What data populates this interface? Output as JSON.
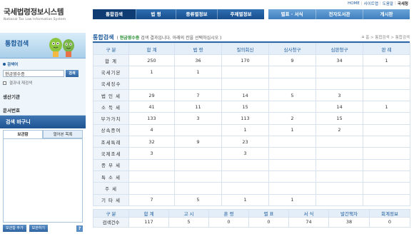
{
  "site": {
    "title_ko": "국세법령정보시스템",
    "title_en": "National Tax Law Information System"
  },
  "top_links": [
    "HOME",
    "사이트맵",
    "도움말",
    "국세청"
  ],
  "nav": {
    "group1": [
      "통합검색",
      "법 령",
      "종류별정보",
      "주제별정보"
    ],
    "group2": [
      "별표 · 서식",
      "전자도서관",
      "게시판"
    ],
    "active_index": 0
  },
  "sidebar": {
    "title": "통합검색",
    "search_label": "검색어",
    "search_value": "현금영수증",
    "search_button": "검색",
    "within_results": "결과내 재검색",
    "links": [
      "생산기관",
      "문서번호"
    ],
    "basket_title": "검색 바구니",
    "tabs": [
      "보관함",
      "열어본 목록"
    ],
    "buttons": [
      "보관함 추가",
      "보관하기"
    ],
    "help": "?"
  },
  "main": {
    "title": "통합검색",
    "subtitle_pre": "(",
    "keyword": "현금영수증",
    "subtitle_post": "검색 결과입니다. 아래의 칸을 선택하십시오 )",
    "breadcrumb": "홈 > 통합검색 > 통합검색"
  },
  "results_table": {
    "headers": [
      "구 분",
      "합 계",
      "법 령",
      "질의회신",
      "심사청구",
      "심판청구",
      "판 례"
    ],
    "rows": [
      [
        "합 계",
        "250",
        "36",
        "170",
        "9",
        "34",
        "1"
      ],
      [
        "국세기본",
        "1",
        "1",
        "",
        "",
        "",
        ""
      ],
      [
        "국세징수",
        "",
        "",
        "",
        "",
        "",
        ""
      ],
      [
        "법 인 세",
        "29",
        "7",
        "14",
        "5",
        "3",
        ""
      ],
      [
        "소 득 세",
        "41",
        "11",
        "15",
        "",
        "14",
        "1"
      ],
      [
        "부가가치",
        "133",
        "3",
        "113",
        "2",
        "15",
        ""
      ],
      [
        "상속증여",
        "4",
        "",
        "1",
        "1",
        "2",
        ""
      ],
      [
        "조세특례",
        "32",
        "9",
        "23",
        "",
        "",
        ""
      ],
      [
        "국제조세",
        "3",
        "",
        "3",
        "",
        "",
        ""
      ],
      [
        "증 부 세",
        "",
        "",
        "",
        "",
        "",
        ""
      ],
      [
        "특 소 세",
        "",
        "",
        "",
        "",
        "",
        ""
      ],
      [
        "주  세",
        "",
        "",
        "",
        "",
        "",
        ""
      ],
      [
        "기 타 세",
        "7",
        "5",
        "1",
        "1",
        "",
        ""
      ]
    ]
  },
  "count_table": {
    "headers": [
      "구 분",
      "합 계",
      "고 시",
      "훈 령",
      "별 표",
      "서 식",
      "발간책자",
      "회계정보"
    ],
    "rows": [
      [
        "검색건수",
        "117",
        "5",
        "0",
        "0",
        "74",
        "38",
        "0"
      ]
    ]
  },
  "colors": {
    "brand_blue": "#1d5a9c",
    "header_blue": "#e3eef8",
    "keyword_green": "#1f8a2c"
  }
}
